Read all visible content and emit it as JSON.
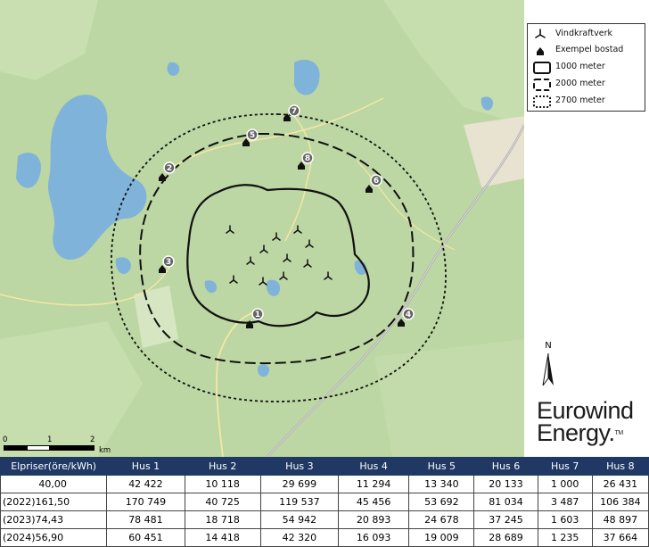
{
  "legend": {
    "items": [
      {
        "label": "Vindkraftverk",
        "icon": "wind-turbine-icon"
      },
      {
        "label": "Exempel bostad",
        "icon": "house-icon"
      },
      {
        "label": "1000 meter",
        "icon": "solid-boundary-icon"
      },
      {
        "label": "2000 meter",
        "icon": "dashed-boundary-icon"
      },
      {
        "label": "2700 meter",
        "icon": "dotted-boundary-icon"
      }
    ]
  },
  "north_arrow": {
    "label": "N"
  },
  "logo": {
    "line1": "Eurowind",
    "line2": "Energy.",
    "tm": "TM"
  },
  "scale_bar": {
    "ticks": [
      "0",
      "1",
      "2"
    ],
    "unit": "km"
  },
  "houses": [
    {
      "id": "1"
    },
    {
      "id": "2"
    },
    {
      "id": "3"
    },
    {
      "id": "4"
    },
    {
      "id": "5"
    },
    {
      "id": "6"
    },
    {
      "id": "7"
    },
    {
      "id": "8"
    }
  ],
  "turbine_count": 10,
  "colors": {
    "map_background": "#bcd7a3",
    "water": "#7fb3d9",
    "table_header": "#1f3864"
  },
  "table": {
    "headers": [
      "Elpriser(öre/kWh)",
      "Hus 1",
      "Hus 2",
      "Hus 3",
      "Hus 4",
      "Hus 5",
      "Hus 6",
      "Hus 7",
      "Hus 8"
    ],
    "rows": [
      [
        "40,00",
        "42 422",
        "10 118",
        "29 699",
        "11 294",
        "13 340",
        "20 133",
        "1 000",
        "26 431"
      ],
      [
        "(2022)161,50",
        "170 749",
        "40 725",
        "119 537",
        "45 456",
        "53 692",
        "81 034",
        "3 487",
        "106 384"
      ],
      [
        "(2023)74,43",
        "78 481",
        "18 718",
        "54 942",
        "20 893",
        "24 678",
        "37 245",
        "1 603",
        "48 897"
      ],
      [
        "(2024)56,90",
        "60 451",
        "14 418",
        "42 320",
        "16 093",
        "19 009",
        "28 689",
        "1 235",
        "37 664"
      ]
    ]
  }
}
